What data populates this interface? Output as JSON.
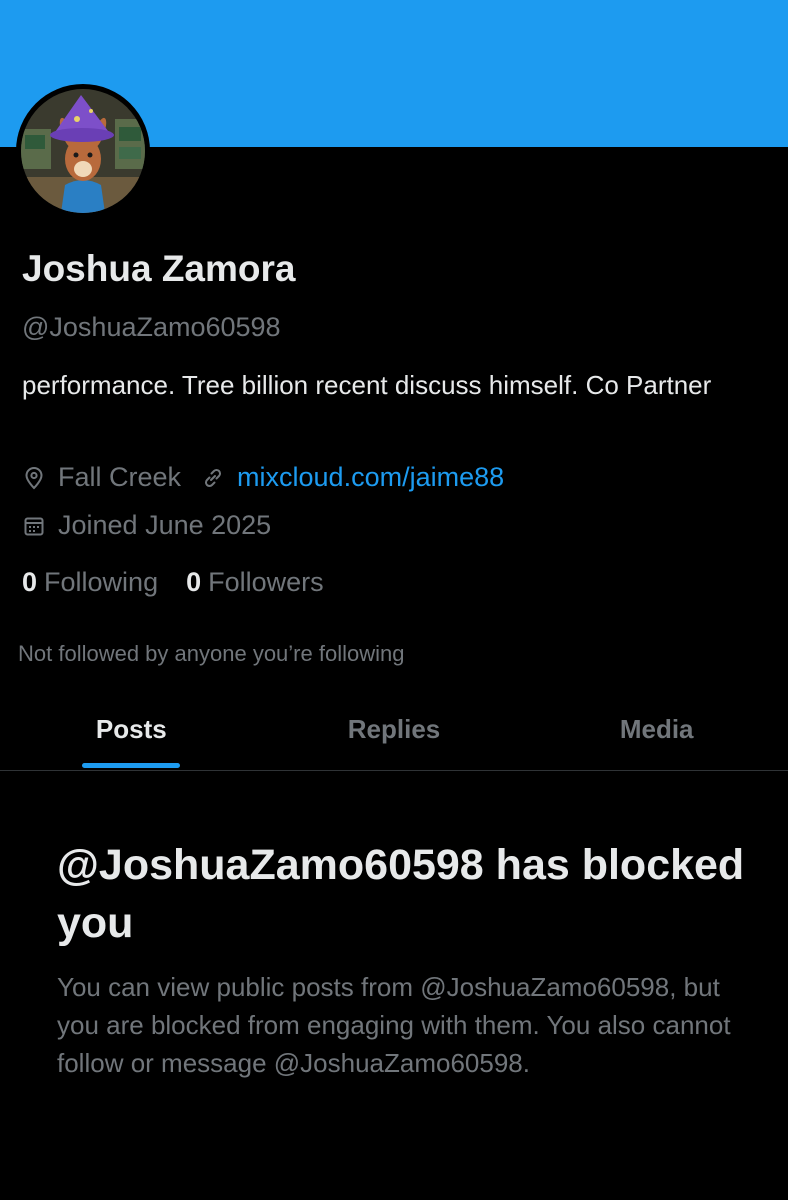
{
  "profile": {
    "name": "Joshua Zamora",
    "handle": "@JoshuaZamo60598",
    "bio": "performance. Tree billion recent discuss himself. Co Partner",
    "location": "Fall Creek",
    "website": "mixcloud.com/jaime88",
    "joined": "Joined June 2025",
    "following_count": "0",
    "following_label": "Following",
    "followers_count": "0",
    "followers_label": "Followers",
    "mutuals_note": "Not followed by anyone you’re following",
    "avatar_icon": "avatar-kangaroo-wizard",
    "location_icon": "location-pin-icon",
    "link_icon": "link-icon",
    "calendar_icon": "calendar-icon"
  },
  "tabs": [
    {
      "label": "Posts",
      "active": true
    },
    {
      "label": "Replies",
      "active": false
    },
    {
      "label": "Media",
      "active": false
    }
  ],
  "blocked": {
    "title": "@JoshuaZamo60598 has blocked you",
    "message": "You can view public posts from @JoshuaZamo60598, but you are blocked from engaging with them. You also cannot follow or message @JoshuaZamo60598."
  },
  "colors": {
    "banner": "#1d9bf0",
    "accent": "#1d9bf0",
    "background": "#000000",
    "primary_text": "#e7e9ea",
    "secondary_text": "#71767b"
  }
}
